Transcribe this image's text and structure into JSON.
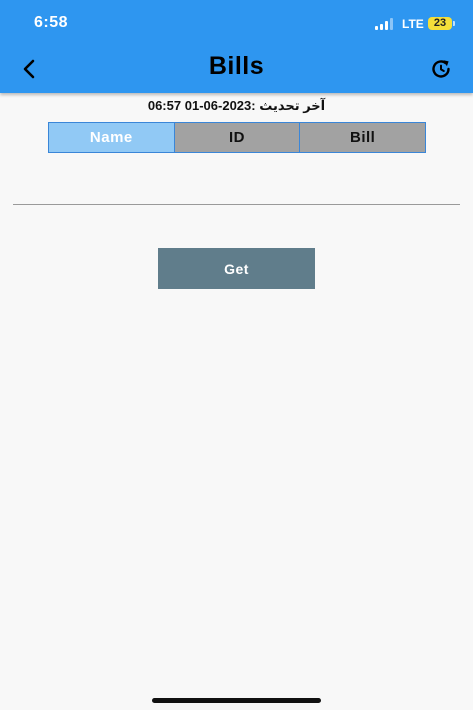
{
  "status_bar": {
    "time": "6:58",
    "network": "LTE",
    "battery": "23",
    "signal_bars": 3
  },
  "header": {
    "title": "Bills",
    "back_icon": "chevron-left-icon",
    "refresh_icon": "refresh-icon"
  },
  "last_update": "آخر تحديث :2023-06-01 06:57",
  "tabs": [
    {
      "label": "Name",
      "active": true
    },
    {
      "label": "ID",
      "active": false
    },
    {
      "label": "Bill",
      "active": false
    }
  ],
  "search": {
    "value": "",
    "placeholder": ""
  },
  "get_button": {
    "label": "Get"
  },
  "colors": {
    "header_bg": "#2e96f0",
    "tab_active_bg": "#91c9f5",
    "tab_inactive_bg": "#a2a2a2",
    "button_bg": "#607d8b",
    "battery_bg": "#f5df3a"
  }
}
